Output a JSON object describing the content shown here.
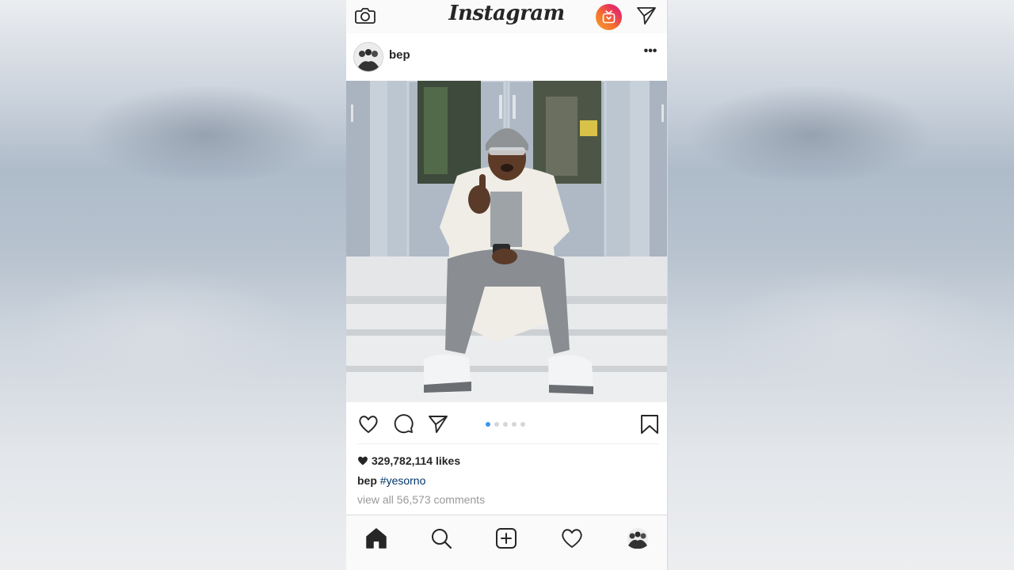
{
  "app": {
    "name": "Instagram",
    "accent_color": "#3897f0",
    "hashtag_color": "#003569"
  },
  "topbar": {
    "logo_text": "Instagram",
    "left_icon": "camera-icon",
    "right_icons": [
      "igtv-icon",
      "direct-message-icon"
    ]
  },
  "post": {
    "username": "bep",
    "more_label": "•••",
    "image": "photo-man-sitting-on-steps",
    "carousel": {
      "count": 5,
      "active": 0
    },
    "likes_count": "329,782,114",
    "likes_suffix": " likes",
    "caption_user": "bep",
    "caption_hashtag": "#yesorno",
    "comments_link": "view all 56,573 comments"
  },
  "actions": {
    "icons": [
      "like-icon",
      "comment-icon",
      "share-icon",
      "save-icon"
    ]
  },
  "bottom_nav": {
    "items": [
      "home-icon",
      "search-icon",
      "new-post-icon",
      "activity-icon",
      "profile-avatar"
    ],
    "active": "home-icon"
  }
}
